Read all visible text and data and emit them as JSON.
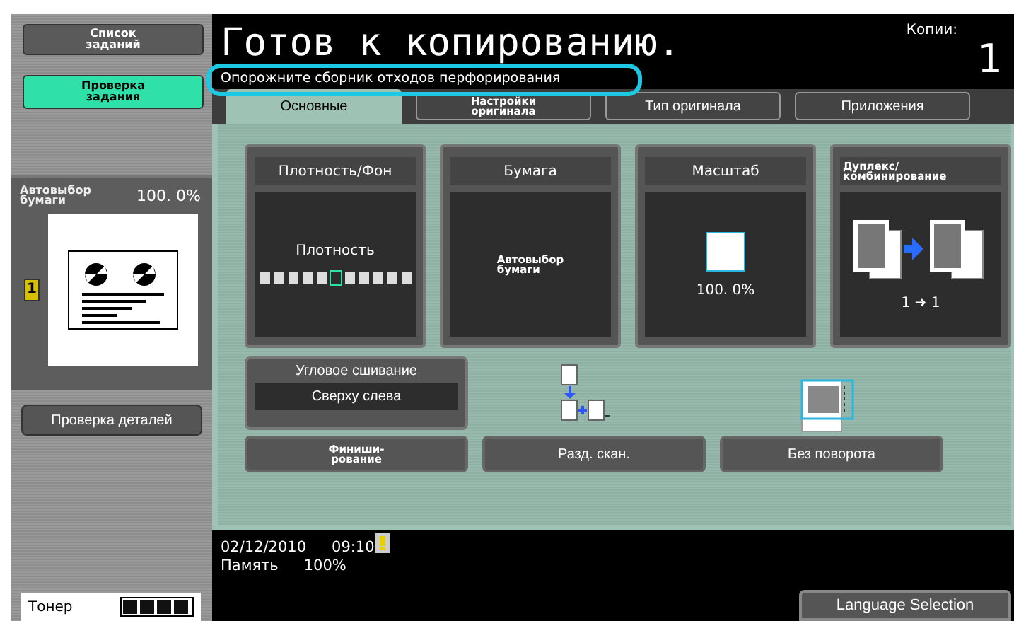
{
  "sidebar": {
    "buttons": [
      {
        "label": "Список\nзаданий",
        "selected": false
      },
      {
        "label": "Проверка\nзадания",
        "selected": true
      }
    ],
    "preview": {
      "paper": "Автовыбор\nбумаги",
      "zoom": "100. 0%",
      "copies_digit": "1"
    },
    "details_button": "Проверка деталей",
    "toner": {
      "label": "Тонер",
      "level": 1
    }
  },
  "header": {
    "title": "Готов к копированию.",
    "message": "Опорожните сборник отходов перфорирования",
    "copies_label": "Копии:",
    "copies": "1"
  },
  "tabs": [
    {
      "label": "Основные",
      "selected": true
    },
    {
      "label": "Настройки\nоригинала",
      "selected": false
    },
    {
      "label": "Тип оригинала",
      "selected": false
    },
    {
      "label": "Приложения",
      "selected": false
    }
  ],
  "cards": [
    {
      "kind": "density",
      "title": "Плотность/Фон",
      "label": "Плотность",
      "cells": [
        {
          "selected": false
        },
        {
          "selected": false
        },
        {
          "selected": false
        },
        {
          "selected": false
        },
        {
          "selected": false
        },
        {
          "selected": true
        },
        {
          "selected": false
        },
        {
          "selected": false
        },
        {
          "selected": false
        },
        {
          "selected": false
        },
        {
          "selected": false
        }
      ]
    },
    {
      "kind": "paper",
      "title": "Бумага",
      "label": "Автовыбор\nбумаги"
    },
    {
      "kind": "zoom",
      "title": "Масштаб",
      "label": "100. 0%"
    },
    {
      "kind": "duplex",
      "title": "Дуплекс/\nкомбинирование",
      "label": "1 ➜ 1"
    }
  ],
  "staple": {
    "title": "Угловое сшивание",
    "value": "Сверху слева"
  },
  "buttons": [
    {
      "label": "Финиши-\nрование"
    },
    {
      "label": "Разд. скан."
    },
    {
      "label": "Без поворота"
    }
  ],
  "footer": {
    "date": "02/12/2010",
    "time": "09:10",
    "memory_label": "Память",
    "memory": "100%",
    "language_button": "Language Selection"
  }
}
